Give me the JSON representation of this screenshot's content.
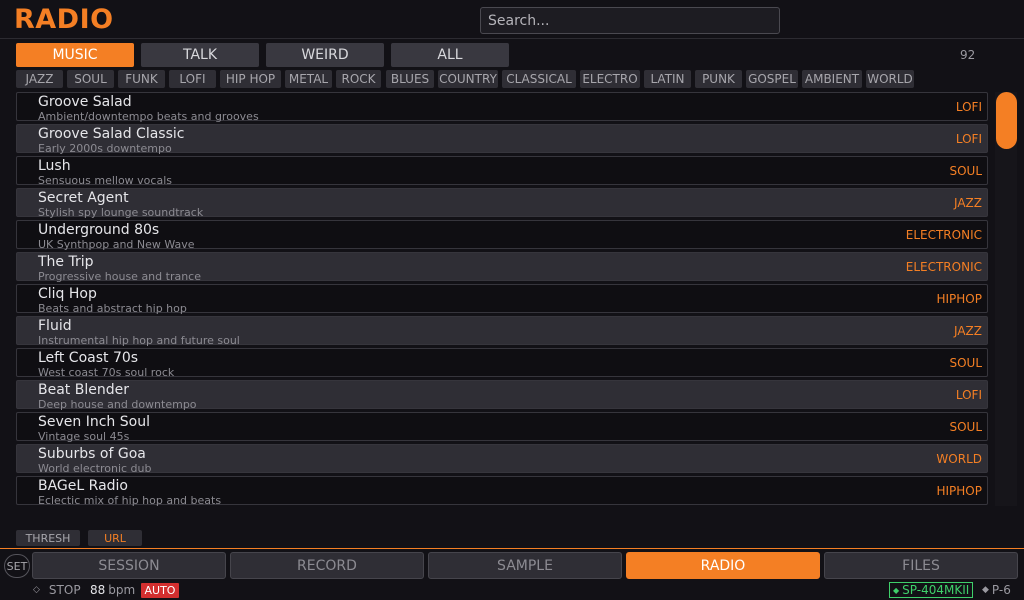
{
  "app": {
    "title": "RADIO"
  },
  "search": {
    "placeholder": "Search..."
  },
  "category_tabs": [
    {
      "label": "MUSIC",
      "active": true
    },
    {
      "label": "TALK",
      "active": false
    },
    {
      "label": "WEIRD",
      "active": false
    },
    {
      "label": "ALL",
      "active": false
    }
  ],
  "station_count": "92",
  "genre_chips": [
    "JAZZ",
    "SOUL",
    "FUNK",
    "LOFI",
    "HIP HOP",
    "METAL",
    "ROCK",
    "BLUES",
    "COUNTRY",
    "CLASSICAL",
    "ELECTRO",
    "LATIN",
    "PUNK",
    "GOSPEL",
    "AMBIENT",
    "WORLD"
  ],
  "stations": [
    {
      "name": "Groove Salad",
      "description": "Ambient/downtempo beats and grooves",
      "genre": "LOFI"
    },
    {
      "name": "Groove Salad Classic",
      "description": "Early 2000s downtempo",
      "genre": "LOFI"
    },
    {
      "name": "Lush",
      "description": "Sensuous mellow vocals",
      "genre": "SOUL"
    },
    {
      "name": "Secret Agent",
      "description": "Stylish spy lounge soundtrack",
      "genre": "JAZZ"
    },
    {
      "name": "Underground 80s",
      "description": "UK Synthpop and New Wave",
      "genre": "ELECTRONIC"
    },
    {
      "name": "The Trip",
      "description": "Progressive house and trance",
      "genre": "ELECTRONIC"
    },
    {
      "name": "Cliq Hop",
      "description": "Beats and abstract hip hop",
      "genre": "HIPHOP"
    },
    {
      "name": "Fluid",
      "description": "Instrumental hip hop and future soul",
      "genre": "JAZZ"
    },
    {
      "name": "Left Coast 70s",
      "description": "West coast 70s soul rock",
      "genre": "SOUL"
    },
    {
      "name": "Beat Blender",
      "description": "Deep house and downtempo",
      "genre": "LOFI"
    },
    {
      "name": "Seven Inch Soul",
      "description": "Vintage soul 45s",
      "genre": "SOUL"
    },
    {
      "name": "Suburbs of Goa",
      "description": "World electronic dub",
      "genre": "WORLD"
    },
    {
      "name": "BAGeL Radio",
      "description": "Eclectic mix of hip hop and beats",
      "genre": "HIPHOP"
    }
  ],
  "filter_buttons": [
    {
      "label": "THRESH",
      "active": false
    },
    {
      "label": "URL",
      "active": true
    }
  ],
  "set_button": "SET",
  "nav_tabs": [
    {
      "label": "SESSION",
      "active": false
    },
    {
      "label": "RECORD",
      "active": false
    },
    {
      "label": "SAMPLE",
      "active": false
    },
    {
      "label": "RADIO",
      "active": true
    },
    {
      "label": "FILES",
      "active": false
    }
  ],
  "status": {
    "transport": "STOP",
    "bpm": "88",
    "bpm_unit": "bpm",
    "auto": "AUTO",
    "device": "SP-404MKII",
    "preset": "P-6"
  },
  "colors": {
    "accent": "#f47f24",
    "background": "#121116",
    "row_alt": "#2f2e35",
    "auto_badge": "#d32f2f",
    "device_connected": "#3fcf6a"
  },
  "icons": {
    "status_marker": "diamond-icon",
    "device_dot": "diamond-icon"
  }
}
